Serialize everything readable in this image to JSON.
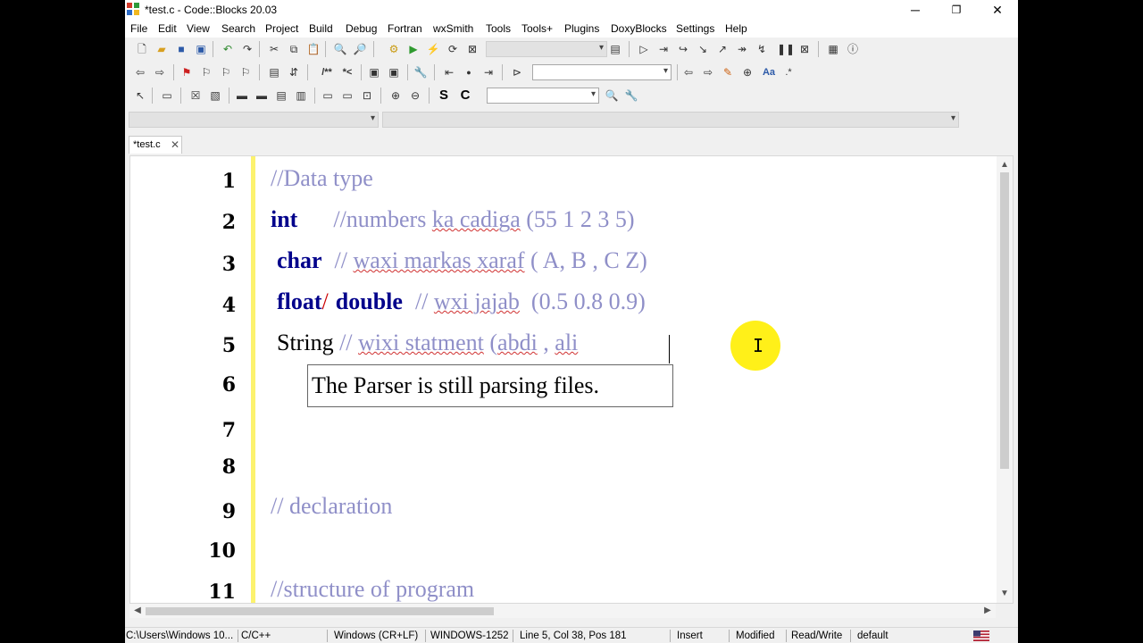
{
  "window": {
    "title": "*test.c - Code::Blocks 20.03",
    "controls": {
      "minimize": "─",
      "restore": "❐",
      "close": "✕"
    }
  },
  "menu": [
    "File",
    "Edit",
    "View",
    "Search",
    "Project",
    "Build",
    "Debug",
    "Fortran",
    "wxSmith",
    "Tools",
    "Tools+",
    "Plugins",
    "DoxyBlocks",
    "Settings",
    "Help"
  ],
  "toolbar": {
    "s_label": "S",
    "c_label": "C"
  },
  "tab": {
    "label": "*test.c",
    "close": "✕"
  },
  "editor": {
    "line_numbers": [
      "1",
      "2",
      "3",
      "4",
      "5",
      "6",
      "7",
      "8",
      "9",
      "10",
      "11"
    ],
    "lines": {
      "l1_comment": "//Data type",
      "l2_kw": "int",
      "l2_comment_a": "//numbers ",
      "l2_spell": "ka cadiga",
      "l2_comment_b": " (55 1 2 3 5)",
      "l3_kw": "char",
      "l3_comment_a": "// ",
      "l3_spell": "waxi markas xaraf",
      "l3_comment_b": " ( A, B , C Z)",
      "l4_kw1": "float",
      "l4_op": "/",
      "l4_kw2": "double",
      "l4_comment_a": "// ",
      "l4_spell": "wxi jajab",
      "l4_comment_b": "  (0.5 0.8 0.9)",
      "l5_plain": "String",
      "l5_comment_a": " // ",
      "l5_spell1": "wixi statment",
      "l5_comment_b": " (",
      "l5_spell2": "abdi",
      "l5_comment_c": " , ",
      "l5_spell3": "ali",
      "l9_comment": "// declaration",
      "l11_comment": "//structure of program"
    },
    "tooltip": "The Parser is still parsing files."
  },
  "status": {
    "path": "C:\\Users\\Windows 10...",
    "lang": "C/C++",
    "eol": "Windows (CR+LF)",
    "encoding": "WINDOWS-1252",
    "position": "Line 5, Col 38, Pos 181",
    "mode": "Insert",
    "modified": "Modified",
    "access": "Read/Write",
    "profile": "default"
  }
}
